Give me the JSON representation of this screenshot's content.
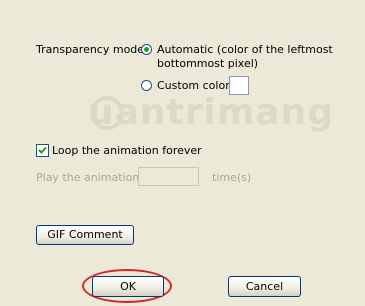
{
  "transparency": {
    "label": "Transparency mode:",
    "automatic_line1": "Automatic (color of the leftmost",
    "automatic_line2": "bottommost pixel)",
    "custom_label": "Custom color:",
    "selected": "automatic"
  },
  "loop": {
    "label": "Loop the animation forever",
    "checked": true
  },
  "play": {
    "label": "Play the animation",
    "input_value": "",
    "suffix": "time(s)"
  },
  "buttons": {
    "gif_comment": "GIF Comment",
    "ok": "OK",
    "cancel": "Cancel"
  },
  "watermark": {
    "text": "uantrimang"
  },
  "colors": {
    "background": "#ece9d8",
    "radio_selected": "#21a121",
    "highlight_ring": "#d7262b",
    "disabled_text": "#aca899"
  }
}
